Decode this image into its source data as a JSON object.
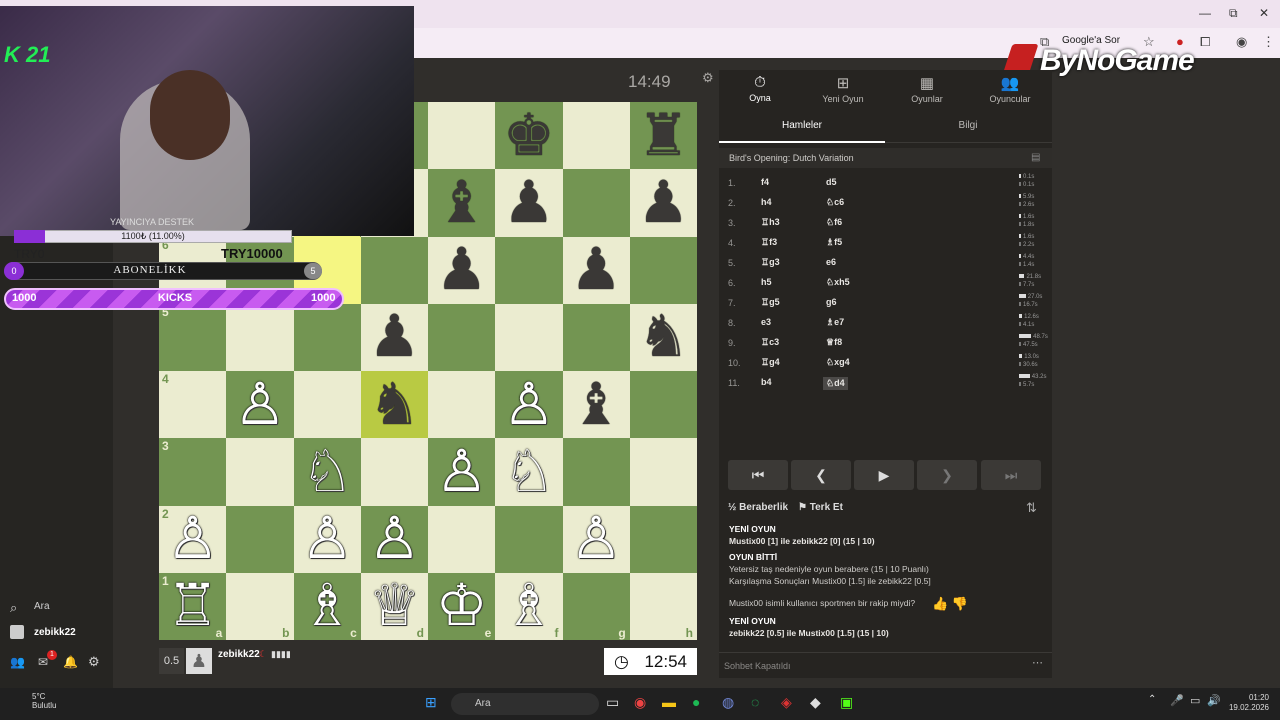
{
  "browser": {
    "ask_google": "Google'a Sor",
    "watermark": "ByNoGame",
    "minimize": "—",
    "restore": "⧉",
    "close": "✕"
  },
  "stream_overlay": {
    "channel_badge": "K 21",
    "donation_title": "YAYINCIYA DESTEK",
    "donation_progress": "1100₺ (11.00%)",
    "donation_fraction": 0.11,
    "try_left": "TRY0",
    "try_right": "TRY10000",
    "subscription_left": "0",
    "subscription_label": "ABONELİKK",
    "subscription_right": "5",
    "kicks_left": "1000",
    "kicks_label": "KICKS",
    "kicks_right": "1000"
  },
  "left_sidebar": {
    "search_label": "Ara",
    "username": "zebikk22",
    "mail_badge": "1"
  },
  "game": {
    "top_clock": "14:49",
    "player_score": "0.5",
    "player_name": "zebikk22",
    "player_clock": "12:54",
    "board": [
      [
        "",
        "",
        "",
        "♟",
        "",
        "♚",
        "",
        "♜"
      ],
      [
        "",
        "",
        "",
        "",
        "♝",
        "♟",
        "",
        "♟"
      ],
      [
        "",
        "",
        "",
        "",
        "♟",
        "",
        "♟",
        ""
      ],
      [
        "",
        "",
        "",
        "♟",
        "",
        "",
        "",
        "♞"
      ],
      [
        "",
        "♙",
        "",
        "♞",
        "",
        "♙",
        "♝",
        ""
      ],
      [
        "",
        "",
        "♘",
        "",
        "♙",
        "♘",
        "",
        ""
      ],
      [
        "♙",
        "",
        "♙",
        "♙",
        "",
        "",
        "♙",
        ""
      ],
      [
        "♖",
        "",
        "♗",
        "♕",
        "♔",
        "♗",
        "",
        ""
      ]
    ],
    "ranks": [
      "6",
      "5",
      "4",
      "3",
      "2",
      "1"
    ],
    "files": [
      "a",
      "b",
      "c",
      "d",
      "e",
      "f",
      "g",
      "h"
    ]
  },
  "panel": {
    "nav": [
      {
        "label": "Oyna",
        "icon": "⏱"
      },
      {
        "label": "Yeni Oyun",
        "icon": "⊞"
      },
      {
        "label": "Oyunlar",
        "icon": "▦"
      },
      {
        "label": "Oyuncular",
        "icon": "👥"
      }
    ],
    "tab_moves": "Hamleler",
    "tab_info": "Bilgi",
    "opening": "Bird's Opening: Dutch Variation",
    "moves": [
      {
        "n": "1.",
        "w": "f4",
        "b": "d5",
        "tw": "0.1s",
        "tb": "0.1s"
      },
      {
        "n": "2.",
        "w": "h4",
        "b": "♘c6",
        "tw": "5.9s",
        "tb": "2.6s"
      },
      {
        "n": "3.",
        "w": "♖h3",
        "b": "♘f6",
        "tw": "1.6s",
        "tb": "1.8s"
      },
      {
        "n": "4.",
        "w": "♖f3",
        "b": "♗f5",
        "tw": "1.6s",
        "tb": "2.2s"
      },
      {
        "n": "5.",
        "w": "♖g3",
        "b": "e6",
        "tw": "4.4s",
        "tb": "1.4s"
      },
      {
        "n": "6.",
        "w": "h5",
        "b": "♘xh5",
        "tw": "21.8s",
        "tb": "7.7s"
      },
      {
        "n": "7.",
        "w": "♖g5",
        "b": "g6",
        "tw": "27.0s",
        "tb": "16.7s"
      },
      {
        "n": "8.",
        "w": "e3",
        "b": "♗e7",
        "tw": "12.6s",
        "tb": "4.1s"
      },
      {
        "n": "9.",
        "w": "♖c3",
        "b": "♕f8",
        "tw": "48.7s",
        "tb": "47.5s"
      },
      {
        "n": "10.",
        "w": "♖g4",
        "b": "♘xg4",
        "tw": "13.0s",
        "tb": "30.6s"
      },
      {
        "n": "11.",
        "w": "b4",
        "b": "♘d4",
        "tw": "43.2s",
        "tb": "5.7s"
      }
    ],
    "nav_first": "⏮",
    "nav_prev": "❮",
    "nav_play": "▶",
    "nav_next": "❯",
    "nav_last": "⏭",
    "draw_label": "Beraberlik",
    "resign_label": "Terk Et",
    "chat": [
      {
        "text": "YENİ OYUN",
        "style": "h"
      },
      {
        "text": "Mustix00 [1] ile zebikk22 [0] (15 | 10)",
        "style": "s"
      },
      {
        "text": "OYUN BİTTİ",
        "style": "h"
      },
      {
        "text": "Yetersiz taş nedeniyle oyun berabere (15 | 10 Puanlı)",
        "style": ""
      },
      {
        "text": "Karşılaşma Sonuçları Mustix00 [1.5] ile zebikk22 [0.5]",
        "style": ""
      },
      {
        "text": "Mustix00 isimli kullanıcı sportmen bir rakip miydi?",
        "style": ""
      },
      {
        "text": "YENİ OYUN",
        "style": "h"
      },
      {
        "text": "zebikk22 [0.5] ile Mustix00 [1.5] (15 | 10)",
        "style": "s"
      }
    ],
    "chat_closed": "Sohbet Kapatıldı"
  },
  "taskbar": {
    "temperature": "5°C",
    "weather": "Bulutlu",
    "search": "Ara",
    "time": "01:20",
    "date": "19.02.2026"
  }
}
